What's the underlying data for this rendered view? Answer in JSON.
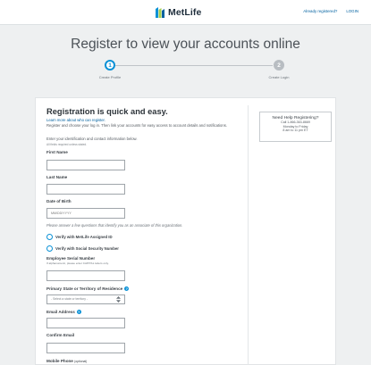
{
  "header": {
    "brand": "MetLife",
    "already_registered": "Already registered?",
    "login_link": "LOGIN"
  },
  "page": {
    "title": "Register to view your accounts online"
  },
  "steps": [
    {
      "number": "1",
      "label": "Create Profile",
      "state": "active"
    },
    {
      "number": "2",
      "label": "Create Login",
      "state": "inactive"
    }
  ],
  "form": {
    "title": "Registration is quick and easy.",
    "learn_more": "Learn more about who can register.",
    "intro": "Register and choose your log in. Then link your accounts for easy access to account details and notifications.",
    "intro2": "Enter your identification and contact information below.",
    "required_note": "All fields required unless stated.",
    "first_name": {
      "label": "First Name",
      "value": ""
    },
    "last_name": {
      "label": "Last Name",
      "value": ""
    },
    "dob": {
      "label": "Date of Birth",
      "placeholder": "MM/DD/YYYY"
    },
    "verify_note": "Please answer a few questions that identify you as an associate of this organization.",
    "verify_options": [
      {
        "label": "Verify with MetLife Assigned ID"
      },
      {
        "label": "Verify with Social Security Number"
      }
    ],
    "employee_serial": {
      "label": "Employee Serial Number",
      "hint": "If alphanumeric, please enter CAPITAL letters only.",
      "value": ""
    },
    "state": {
      "label": "Primary State or Territory of Residence",
      "selected": "- Select a state or territory -"
    },
    "email": {
      "label": "Email Address",
      "value": ""
    },
    "confirm_email": {
      "label": "Confirm Email",
      "value": ""
    },
    "mobile": {
      "label": "Mobile Phone",
      "optional": "(optional)"
    }
  },
  "help": {
    "title": "Need Help Registering?",
    "phone": "Call 1-866-363-8669",
    "days": "Monday to Friday",
    "hours": "8 am to 11 pm ET"
  },
  "colors": {
    "accent": "#0a91d6",
    "link": "#0061a0",
    "background": "#eef0f1"
  }
}
